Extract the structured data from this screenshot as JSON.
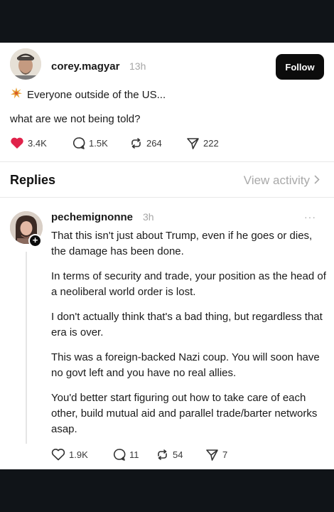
{
  "post": {
    "author": "corey.magyar",
    "time": "13h",
    "follow_label": "Follow",
    "line1": "Everyone outside of the US...",
    "line2": "what are we not being told?",
    "stats": {
      "likes": "3.4K",
      "comments": "1.5K",
      "reposts": "264",
      "shares": "222"
    },
    "icons": {
      "leading_emoji": "sparkle-burst-icon",
      "like": "heart-filled-icon",
      "comment": "comment-icon",
      "repost": "repost-icon",
      "share": "share-icon"
    }
  },
  "replies_header": {
    "label": "Replies",
    "view_activity": "View activity"
  },
  "reply": {
    "author": "pechemignonne",
    "time": "3h",
    "more": "···",
    "paragraphs": [
      "That this isn't just about Trump, even if he goes or dies, the damage has been done.",
      "In terms of security and trade, your position as the head of a neoliberal world order is lost.",
      "I don't actually think that's a bad thing, but regardless that era is over.",
      "This was a foreign-backed Nazi coup. You will soon have no govt left and you have no real allies.",
      "You'd better start figuring out how to take care of each other, build mutual aid and parallel trade/barter networks asap."
    ],
    "stats": {
      "likes": "1.9K",
      "comments": "11",
      "reposts": "54",
      "shares": "7"
    }
  },
  "colors": {
    "like_red": "#e0224a",
    "muted": "#a6a6a6",
    "background": "#101418"
  }
}
